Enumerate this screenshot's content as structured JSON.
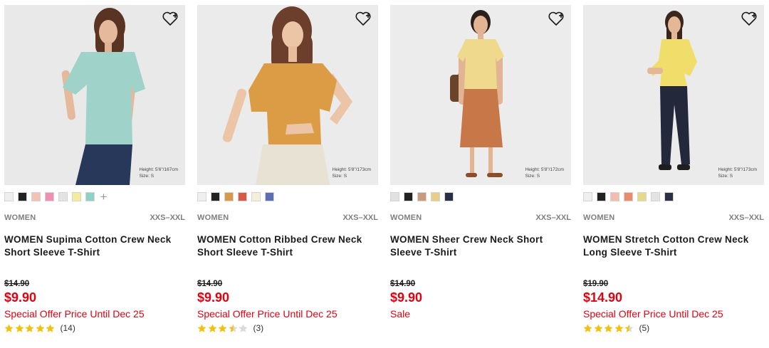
{
  "colors": {
    "accent_red": "#e50010",
    "star_gold": "#f2c00f",
    "star_empty": "#d9d9d9"
  },
  "products": [
    {
      "image_alt": "Model wearing mint crew neck short sleeve t-shirt",
      "photo_bg": "#e9e9e9",
      "model_height": "Height: 5'6\"/167cm",
      "model_size": "Size: S",
      "swatches": [
        "#efefef",
        "#222222",
        "#f2c3b3",
        "#ef8fb2",
        "#e3e3e3",
        "#f4ec9d",
        "#8fd1c9"
      ],
      "has_more_swatches": true,
      "gender": "WOMEN",
      "sizes": "XXS–XXL",
      "name": "WOMEN Supima Cotton Crew Neck Short Sleeve T-Shirt",
      "original_price": "$14.90",
      "price": "$9.90",
      "promo": "Special Offer Price Until Dec 25",
      "rating": 5,
      "review_count": "(14)"
    },
    {
      "image_alt": "Model wearing orange ribbed crew neck t-shirt",
      "photo_bg": "#ebebeb",
      "model_height": "Height: 5'8\"/173cm",
      "model_size": "Size: S",
      "swatches": [
        "#efefef",
        "#222222",
        "#d59a4a",
        "#d75a44",
        "#f5efd8",
        "#5c6fb5"
      ],
      "has_more_swatches": false,
      "gender": "WOMEN",
      "sizes": "XXS–XXL",
      "name": "WOMEN Cotton Ribbed Crew Neck Short Sleeve T-Shirt",
      "original_price": "$14.90",
      "price": "$9.90",
      "promo": "Special Offer Price Until Dec 25",
      "rating": 3.5,
      "review_count": "(3)"
    },
    {
      "image_alt": "Model wearing yellow sheer crew neck t-shirt",
      "photo_bg": "#ececec",
      "model_height": "Height: 5'8\"/172cm",
      "model_size": "Size: S",
      "swatches": [
        "#e1e1e1",
        "#222222",
        "#c99a7e",
        "#e7cf8a",
        "#2a2f45"
      ],
      "has_more_swatches": false,
      "gender": "WOMEN",
      "sizes": "XXS–XXL",
      "name": "WOMEN Sheer Crew Neck Short Sleeve T-Shirt",
      "original_price": "$14.90",
      "price": "$9.90",
      "promo": "Sale",
      "rating": null,
      "review_count": ""
    },
    {
      "image_alt": "Model wearing yellow stretch cotton long sleeve t-shirt",
      "photo_bg": "#ebebeb",
      "model_height": "Height: 5'8\"/173cm",
      "model_size": "Size: S",
      "swatches": [
        "#efefef",
        "#222222",
        "#f4bcb0",
        "#ec8a6d",
        "#e7d98a",
        "#e3e3e3",
        "#2c3148"
      ],
      "has_more_swatches": false,
      "gender": "WOMEN",
      "sizes": "XXS–XXL",
      "name": "WOMEN Stretch Cotton Crew Neck Long Sleeve T-Shirt",
      "original_price": "$19.90",
      "price": "$14.90",
      "promo": "Special Offer Price Until Dec 25",
      "rating": 4.5,
      "review_count": "(5)"
    }
  ]
}
